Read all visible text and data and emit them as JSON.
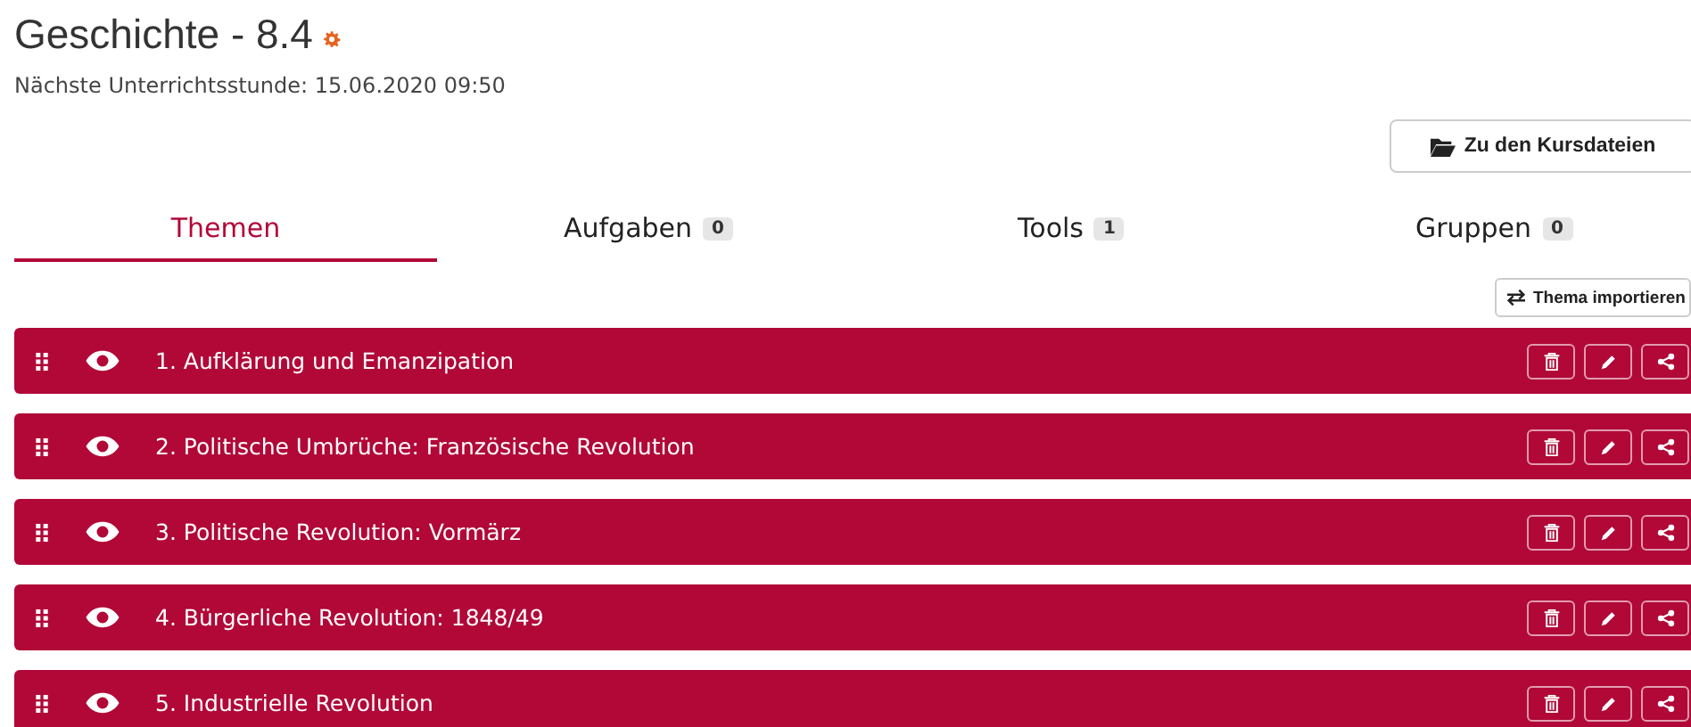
{
  "header": {
    "title": "Geschichte - 8.4",
    "next_lesson": "Nächste Unterrichtsstunde: 15.06.2020 09:50"
  },
  "files_button": "Zu den Kursdateien",
  "tabs": [
    {
      "label": "Themen",
      "selected": true
    },
    {
      "label": "Aufgaben",
      "count": "0",
      "selected": false
    },
    {
      "label": "Tools",
      "count": "1",
      "selected": false
    },
    {
      "label": "Gruppen",
      "count": "0",
      "selected": false
    }
  ],
  "import_button": "Thema importieren",
  "topics": [
    {
      "title": "1. Aufklärung und Emanzipation",
      "visible": true
    },
    {
      "title": "2. Politische Umbrüche: Französische Revolution",
      "visible": true
    },
    {
      "title": "3. Politische Revolution: Vormärz",
      "visible": true
    },
    {
      "title": "4. Bürgerliche Revolution: 1848/49",
      "visible": true
    },
    {
      "title": "5. Industrielle Revolution",
      "visible": true
    }
  ]
}
